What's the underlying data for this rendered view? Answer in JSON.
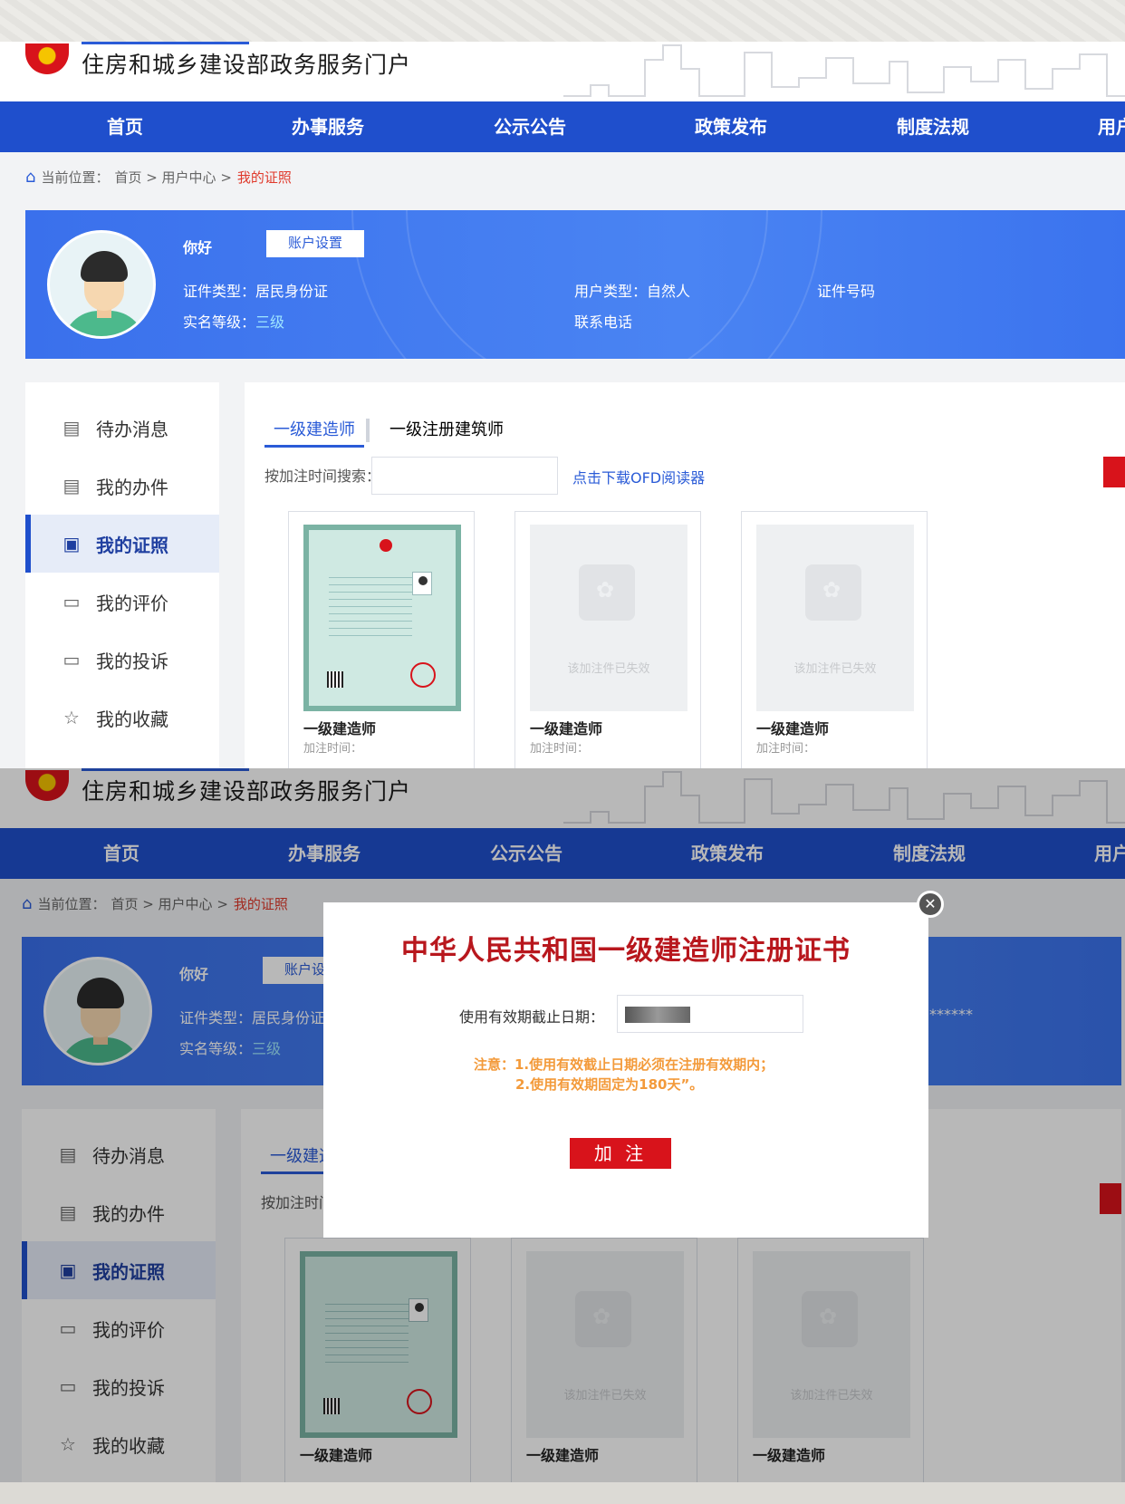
{
  "site": {
    "title": "住房和城乡建设部政务服务门户"
  },
  "nav": [
    "首页",
    "办事服务",
    "公示公告",
    "政策发布",
    "制度法规",
    "用户"
  ],
  "breadcrumb": {
    "label": "当前位置：",
    "path": "首页 > 用户中心 >",
    "current": "我的证照"
  },
  "profile": {
    "greeting": "你好",
    "account_button": "账户设置",
    "id_type_label": "证件类型：",
    "id_type_value": "居民身份证",
    "realname_label": "实名等级：",
    "realname_value": "三级",
    "user_type_label": "用户类型：",
    "user_type_value": "自然人",
    "phone_label": "联系电话",
    "id_number_label": "证件号码",
    "id_number_value": "******"
  },
  "sidebar": {
    "items": [
      {
        "label": "待办消息",
        "icon": "message-icon"
      },
      {
        "label": "我的办件",
        "icon": "document-icon"
      },
      {
        "label": "我的证照",
        "icon": "id-card-icon",
        "active": true
      },
      {
        "label": "我的评价",
        "icon": "comment-icon"
      },
      {
        "label": "我的投诉",
        "icon": "complaint-icon"
      },
      {
        "label": "我的收藏",
        "icon": "star-icon"
      }
    ]
  },
  "main": {
    "tabs": [
      {
        "label": "一级建造师",
        "active": true
      },
      {
        "label": "一级注册建筑师"
      }
    ],
    "search_label": "按加注时间搜索：",
    "search_value": "",
    "ofd_link": "点击下载OFD阅读器",
    "cards": [
      {
        "name": "一级建造师",
        "date_label": "加注时间：",
        "status": ""
      },
      {
        "name": "一级建造师",
        "date_label": "加注时间：",
        "status": "该加注件已失效"
      },
      {
        "name": "一级建造师",
        "date_label": "加注时间：",
        "status": "该加注件已失效"
      }
    ]
  },
  "modal": {
    "title": "中华人民共和国一级建造师注册证书",
    "expiry_label": "使用有效期截止日期：",
    "note_line1": "注意：1.使用有效截止日期必须在注册有效期内；",
    "note_line2": "2.使用有效期固定为180天”。",
    "add_button": "加 注",
    "close_symbol": "✕"
  },
  "colors": {
    "primary": "#1f4fcc",
    "accent_red": "#d8131b",
    "title_red": "#b8171d",
    "note_orange": "#f39a3a"
  }
}
